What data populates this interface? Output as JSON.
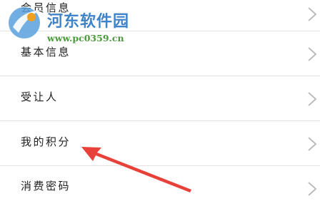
{
  "menu": {
    "items": [
      {
        "label": "会员信息"
      },
      {
        "label": "基本信息"
      },
      {
        "label": "受让人"
      },
      {
        "label": "我的积分"
      },
      {
        "label": "消费密码"
      }
    ]
  },
  "watermark": {
    "title": "河东软件园",
    "url": "www.pc0359.cn"
  },
  "colors": {
    "divider": "#e2e2e2",
    "chevron": "#b5b5b5",
    "arrow": "#e8413a",
    "watermark_title": "#3f83c9",
    "watermark_url": "#4a9a3a"
  },
  "icons": {
    "chevron": "chevron-right-icon",
    "annotation": "red-arrow-icon",
    "logo": "watermark-logo-icon"
  }
}
